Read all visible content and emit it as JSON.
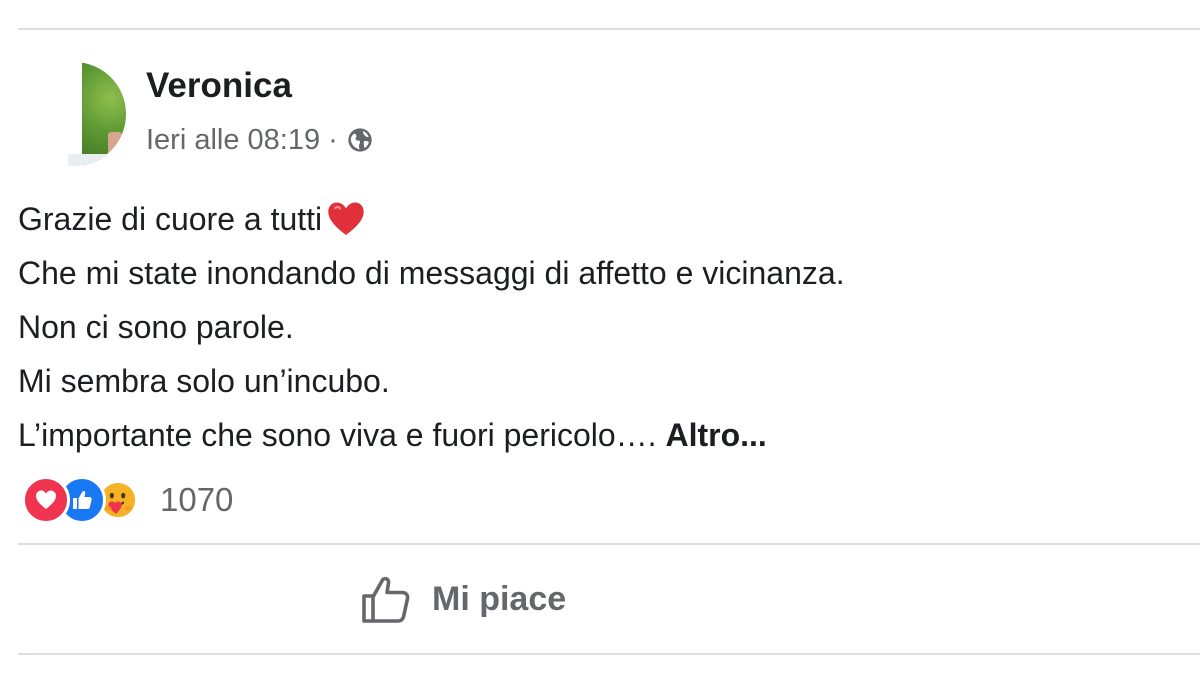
{
  "post": {
    "author": "Veronica",
    "timestamp": "Ieri alle 08:19",
    "separator": "·",
    "audience_icon": "globe-icon",
    "lines": [
      "Grazie di cuore a tutti",
      "Che mi state inondando di messaggi di affetto e vicinanza.",
      "Non ci sono parole.",
      "Mi sembra solo un’incubo.",
      "L’importante che sono viva e fuori pericolo…."
    ],
    "inline_emoji": "heart-emoji",
    "more_label": "Altro..."
  },
  "reactions": {
    "icons": [
      "love-reaction-icon",
      "like-reaction-icon",
      "care-reaction-icon"
    ],
    "count": "1070"
  },
  "actions": {
    "like_label": "Mi piace",
    "like_icon": "thumbs-up-icon"
  },
  "colors": {
    "text_primary": "#1c1e21",
    "text_secondary": "#65676b",
    "divider": "#dadde1",
    "love": "#f0334f",
    "like": "#1877f2",
    "care": "#f7b125"
  }
}
